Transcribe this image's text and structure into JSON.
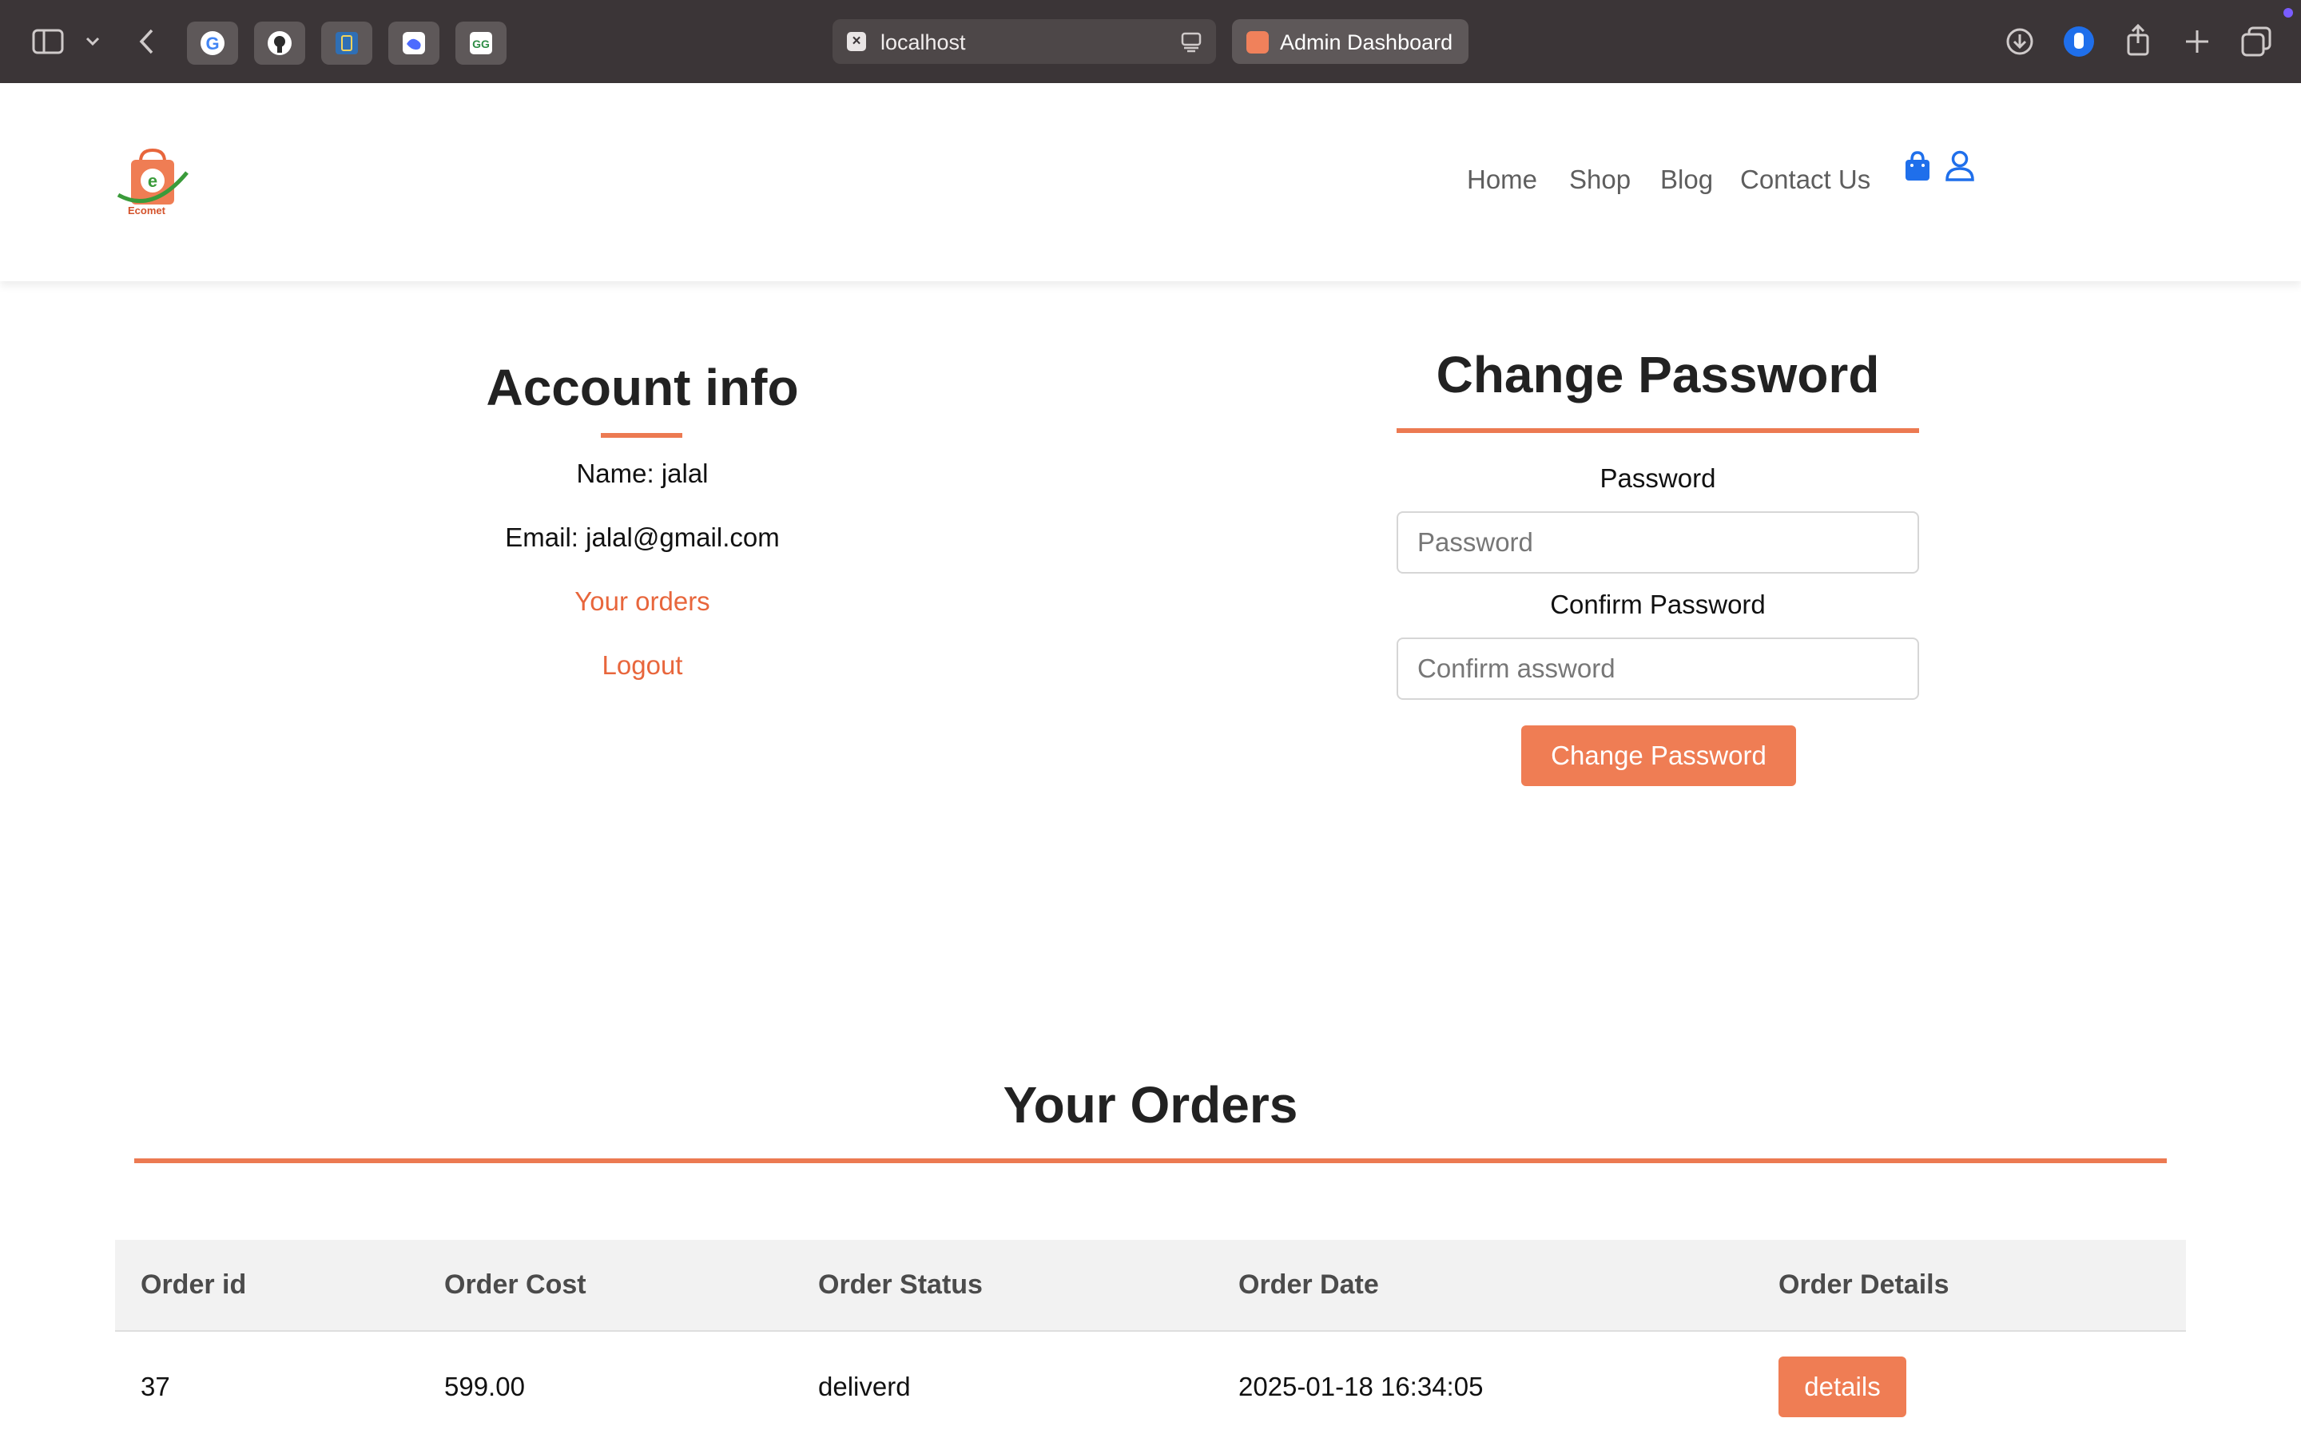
{
  "browser": {
    "url": "localhost",
    "active_tab_title": "Admin Dashboard",
    "accent_color": "#f0815b"
  },
  "site": {
    "logo_text": "Ecomet",
    "nav": [
      "Home",
      "Shop",
      "Blog",
      "Contact Us"
    ],
    "brand_color": "#ef7d54",
    "icon_color": "#1f6feb"
  },
  "account": {
    "title": "Account info",
    "name_line": "Name: jalal",
    "email_line": "Email: jalal@gmail.com",
    "orders_link": "Your orders",
    "logout_link": "Logout"
  },
  "change_password": {
    "title": "Change Password",
    "password_label": "Password",
    "password_placeholder": "Password",
    "confirm_label": "Confirm Password",
    "confirm_placeholder": "Confirm assword",
    "button_label": "Change Password"
  },
  "orders": {
    "title": "Your Orders",
    "columns": [
      "Order id",
      "Order Cost",
      "Order Status",
      "Order Date",
      "Order Details"
    ],
    "rows": [
      {
        "id": "37",
        "cost": "599.00",
        "status": "deliverd",
        "date": "2025-01-18 16:34:05",
        "details_label": "details"
      }
    ]
  }
}
